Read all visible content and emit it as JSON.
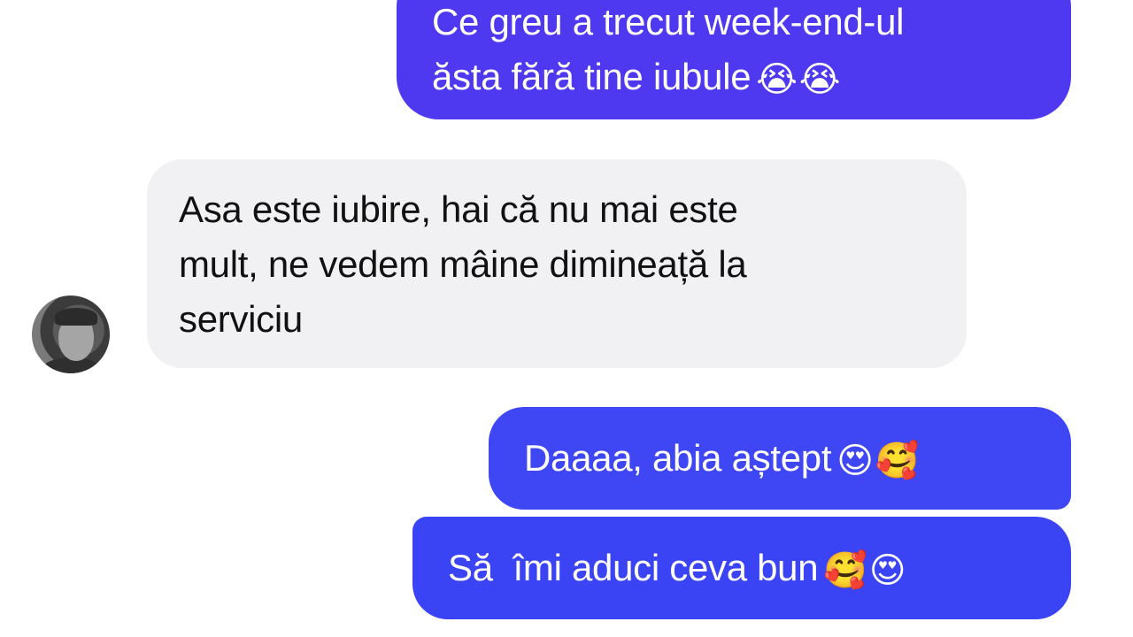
{
  "conversation": {
    "messages": [
      {
        "direction": "outgoing",
        "lines": [
          "Ce greu a trecut week-end-ul",
          "ăsta fără tine iubule"
        ],
        "emojis": [
          "😭",
          "😭"
        ],
        "emoji_names": [
          "loudly-crying-face-icon",
          "loudly-crying-face-icon"
        ]
      },
      {
        "direction": "incoming",
        "lines": [
          "Asa este iubire, hai că nu mai este",
          "mult, ne vedem mâine dimineață la",
          "serviciu"
        ],
        "emojis": [],
        "emoji_names": []
      },
      {
        "direction": "outgoing",
        "lines": [
          "Daaaa, abia aștept"
        ],
        "emojis": [
          "😍",
          "🥰"
        ],
        "emoji_names": [
          "heart-eyes-face-icon",
          "smiling-face-with-hearts-icon"
        ]
      },
      {
        "direction": "outgoing",
        "lines": [
          "Să  îmi aduci ceva bun"
        ],
        "emojis": [
          "🥰",
          "😍"
        ],
        "emoji_names": [
          "smiling-face-with-hearts-icon",
          "heart-eyes-face-icon"
        ]
      }
    ]
  },
  "colors": {
    "outgoing_bubble": "#4237f2",
    "incoming_bubble": "#f1f0f3",
    "outgoing_text": "#ffffff",
    "incoming_text": "#111111",
    "background": "#ffffff"
  },
  "avatar": {
    "icon": "contact-avatar"
  }
}
